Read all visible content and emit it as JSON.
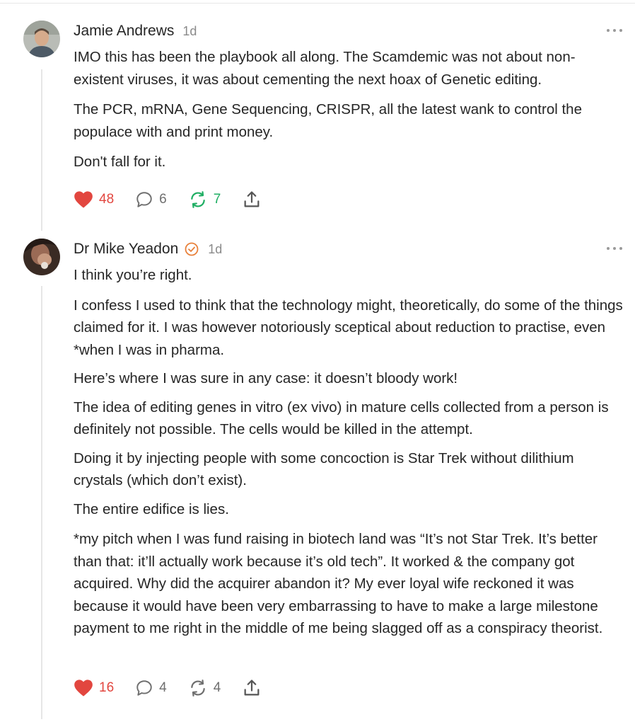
{
  "comments": [
    {
      "author": "Jamie Andrews",
      "time": "1d",
      "avatar_icon": "person-photo-avatar",
      "paragraphs": [
        "IMO this has been the playbook all along. The Scamdemic was not about non-existent viruses, it was about cementing the next hoax of Genetic editing.",
        "The PCR, mRNA, Gene Sequencing, CRISPR, all the latest wank to control the populace with and print money.",
        "Don't fall for it."
      ],
      "likes": "48",
      "replies": "6",
      "restacks": "7",
      "restacked": true
    },
    {
      "author": "Dr Mike Yeadon",
      "time": "1d",
      "avatar_icon": "person-photo-avatar",
      "badge_icon": "verified-badge-icon",
      "paragraphs": [
        "I think you’re right.",
        "I confess I used to think that the technology might, theoretically, do some of the things claimed for it. I was however notoriously sceptical about reduction to practise, even *when I was in pharma.",
        "Here’s where I was sure in any case: it doesn’t bloody work!",
        "The idea of editing genes in vitro (ex vivo) in mature cells collected from a person is definitely not possible. The cells would be killed in the attempt.",
        "Doing it by injecting people with some concoction is Star Trek without dilithium crystals (which don’t exist).",
        "The entire edifice is lies.",
        "*my pitch when I was fund raising in biotech land was “It’s not Star Trek. It’s better than that: it’ll actually work because it’s old tech”. It worked & the company got acquired. Why did the acquirer abandon it? My ever loyal wife reckoned it was because it would have been very embarrassing to have to make a large milestone payment to me right in the middle of me being slagged off as a conspiracy theorist."
      ],
      "likes": "16",
      "replies": "4",
      "restacks": "4",
      "restacked": false
    }
  ],
  "colors": {
    "like": "#e2463f",
    "restack_active": "#1fae63",
    "badge": "#e8803a",
    "muted": "#8a8a8a"
  }
}
